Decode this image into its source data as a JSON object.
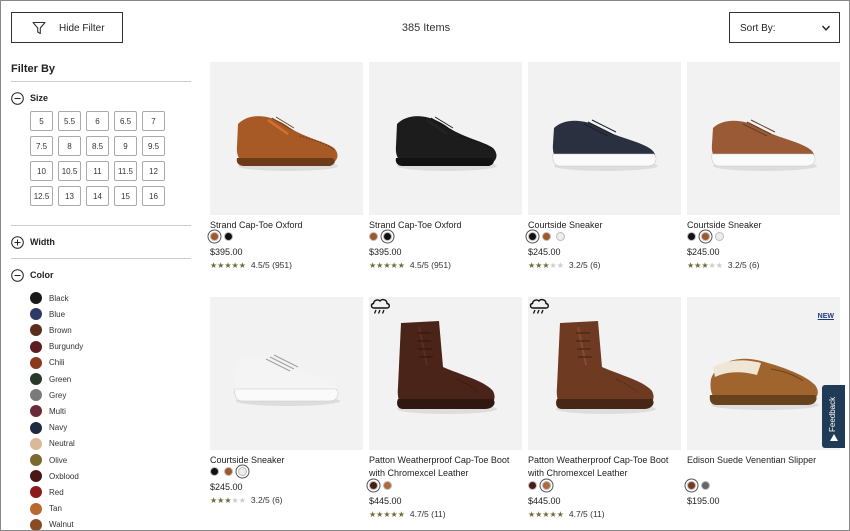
{
  "toolbar": {
    "hide_filter_label": "Hide Filter",
    "items_count": "385 Items",
    "sort_label": "Sort By:"
  },
  "sidebar": {
    "title": "Filter By",
    "size": {
      "label": "Size",
      "options": [
        "5",
        "5.5",
        "6",
        "6.5",
        "7",
        "7.5",
        "8",
        "8.5",
        "9",
        "9.5",
        "10",
        "10.5",
        "11",
        "11.5",
        "12",
        "12.5",
        "13",
        "14",
        "15",
        "16"
      ]
    },
    "width": {
      "label": "Width"
    },
    "color": {
      "label": "Color",
      "options": [
        {
          "name": "Black",
          "hex": "#1a1a1a"
        },
        {
          "name": "Blue",
          "hex": "#2e3a66"
        },
        {
          "name": "Brown",
          "hex": "#5a2e1a"
        },
        {
          "name": "Burgundy",
          "hex": "#5c1f1f"
        },
        {
          "name": "Chili",
          "hex": "#8a3a1e"
        },
        {
          "name": "Green",
          "hex": "#2a3a2a"
        },
        {
          "name": "Grey",
          "hex": "#7a7a7a"
        },
        {
          "name": "Multi",
          "hex": "#6a2a3a"
        },
        {
          "name": "Navy",
          "hex": "#1f2a44"
        },
        {
          "name": "Neutral",
          "hex": "#d9b99a"
        },
        {
          "name": "Olive",
          "hex": "#7a6a2e"
        },
        {
          "name": "Oxblood",
          "hex": "#4a1616"
        },
        {
          "name": "Red",
          "hex": "#8e1a1a"
        },
        {
          "name": "Tan",
          "hex": "#b9692f"
        },
        {
          "name": "Walnut",
          "hex": "#8a4a22"
        }
      ]
    }
  },
  "products": [
    {
      "name": "Strand Cap-Toe Oxford",
      "price": "$395.00",
      "rating": 4.5,
      "rating_text": "4.5/5 (951)",
      "swatches": [
        "#a0582a",
        "#111111"
      ],
      "selected": 0,
      "shoe": "oxford",
      "shoe_color": "#a85a26",
      "badge": ""
    },
    {
      "name": "Strand Cap-Toe Oxford",
      "price": "$395.00",
      "rating": 4.5,
      "rating_text": "4.5/5 (951)",
      "swatches": [
        "#a0582a",
        "#111111"
      ],
      "selected": 1,
      "shoe": "oxford",
      "shoe_color": "#1c1c1c",
      "badge": ""
    },
    {
      "name": "Courtside Sneaker",
      "price": "$245.00",
      "rating": 3.2,
      "rating_text": "3.2/5 (6)",
      "swatches": [
        "#111111",
        "#a0582a",
        "#eeeeee"
      ],
      "selected": 0,
      "shoe": "sneaker",
      "shoe_color": "#2a3040",
      "badge": ""
    },
    {
      "name": "Courtside Sneaker",
      "price": "$245.00",
      "rating": 3.2,
      "rating_text": "3.2/5 (6)",
      "swatches": [
        "#111111",
        "#a0582a",
        "#eeeeee"
      ],
      "selected": 1,
      "shoe": "sneaker",
      "shoe_color": "#9a5a36",
      "badge": ""
    },
    {
      "name": "Courtside Sneaker",
      "price": "$245.00",
      "rating": 3.2,
      "rating_text": "3.2/5 (6)",
      "swatches": [
        "#111111",
        "#a0582a",
        "#eeeeee"
      ],
      "selected": 2,
      "shoe": "sneaker",
      "shoe_color": "#f4f4f4",
      "badge": ""
    },
    {
      "name": "Patton Weatherproof Cap-Toe Boot with Chromexcel Leather",
      "price": "$445.00",
      "rating": 4.7,
      "rating_text": "4.7/5 (11)",
      "swatches": [
        "#4a1e12",
        "#b06a3a"
      ],
      "selected": 0,
      "shoe": "boot",
      "shoe_color": "#4a2418",
      "badge": "weatherproof"
    },
    {
      "name": "Patton Weatherproof Cap-Toe Boot with Chromexcel Leather",
      "price": "$445.00",
      "rating": 4.7,
      "rating_text": "4.7/5 (11)",
      "swatches": [
        "#4a1e12",
        "#b06a3a"
      ],
      "selected": 1,
      "shoe": "boot",
      "shoe_color": "#6e3a22",
      "badge": "weatherproof"
    },
    {
      "name": "Edison Suede Venentian Slipper",
      "price": "$195.00",
      "rating": null,
      "rating_text": "",
      "swatches": [
        "#7a3a22",
        "#666666"
      ],
      "selected": 0,
      "shoe": "slipper",
      "shoe_color": "#a0642e",
      "badge": "NEW"
    }
  ],
  "feedback_label": "Feedback",
  "icons": {
    "filter": "filter-funnel-icon",
    "sort": "chevron-down-icon",
    "weatherproof": "weatherproof-cloud-icon"
  }
}
